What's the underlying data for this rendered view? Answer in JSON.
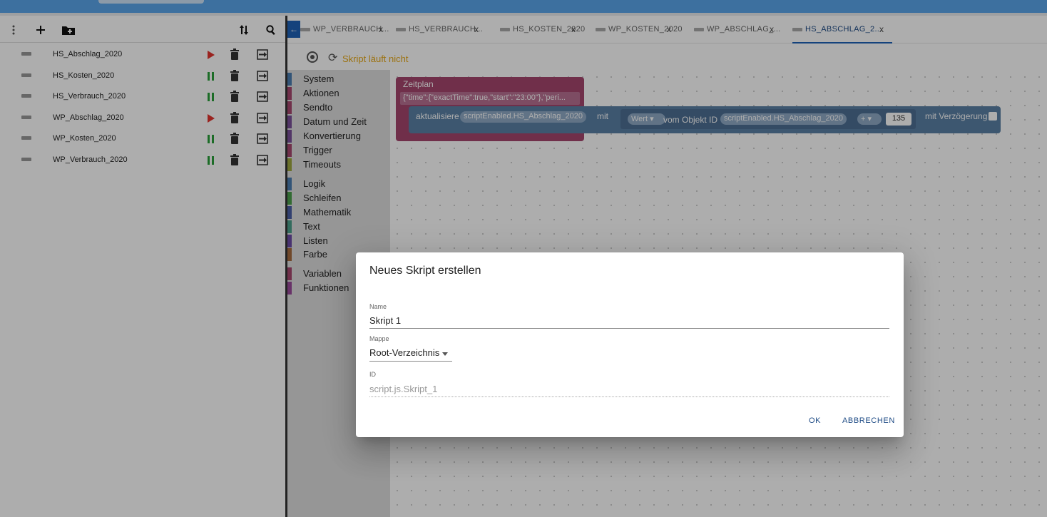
{
  "scripts": [
    {
      "name": "HS_Abschlag_2020",
      "state": "stopped"
    },
    {
      "name": "HS_Kosten_2020",
      "state": "running"
    },
    {
      "name": "HS_Verbrauch_2020",
      "state": "running"
    },
    {
      "name": "WP_Abschlag_2020",
      "state": "stopped"
    },
    {
      "name": "WP_Kosten_2020",
      "state": "running"
    },
    {
      "name": "WP_Verbrauch_2020",
      "state": "running"
    }
  ],
  "tabs": [
    {
      "label": "WP_VERBRAUCH..."
    },
    {
      "label": "HS_VERBRAUCH..."
    },
    {
      "label": "HS_KOSTEN_2020"
    },
    {
      "label": "WP_KOSTEN_2020"
    },
    {
      "label": "WP_ABSCHLAG_..."
    },
    {
      "label": "HS_ABSCHLAG_2..."
    }
  ],
  "tab_close": "x",
  "script_status": "Skript läuft nicht",
  "toolbox": [
    {
      "label": "System",
      "color": "#4a7db0"
    },
    {
      "label": "Aktionen",
      "color": "#a5466e"
    },
    {
      "label": "Sendto",
      "color": "#a5466e"
    },
    {
      "label": "Datum und Zeit",
      "color": "#7a4e99"
    },
    {
      "label": "Konvertierung",
      "color": "#7a4e99"
    },
    {
      "label": "Trigger",
      "color": "#a5466e"
    },
    {
      "label": "Timeouts",
      "color": "#9da53e"
    },
    {
      "label": "Logik",
      "color": "#4a7db0"
    },
    {
      "label": "Schleifen",
      "color": "#4a9e4a"
    },
    {
      "label": "Mathematik",
      "color": "#4a5fa5"
    },
    {
      "label": "Text",
      "color": "#4a9e8a"
    },
    {
      "label": "Listen",
      "color": "#6a4aa5"
    },
    {
      "label": "Farbe",
      "color": "#a56a3e"
    },
    {
      "label": "Variablen",
      "color": "#a5466e"
    },
    {
      "label": "Funktionen",
      "color": "#9a4a9a"
    }
  ],
  "blocks": {
    "zeitplan_title": "Zeitplan",
    "zeitplan_json": "{\"time\":{\"exactTime\":true,\"start\":\"23:00\"},\"peri...",
    "aktualisiere": "aktualisiere",
    "object_id": "scriptEnabled.HS_Abschlag_2020",
    "mit": "mit",
    "wert": "Wert",
    "vom_objekt_id": "vom Objekt ID",
    "object_id2": "scriptEnabled.HS_Abschlag_2020",
    "op": "+",
    "number": "135",
    "mit_verzoegerung": "mit Verzögerung"
  },
  "dialog": {
    "title": "Neues Skript erstellen",
    "name_label": "Name",
    "name_value": "Skript 1",
    "folder_label": "Mappe",
    "folder_value": "Root-Verzeichnis",
    "id_label": "ID",
    "id_value": "script.js.Skript_1",
    "ok": "OK",
    "cancel": "ABBRECHEN"
  }
}
